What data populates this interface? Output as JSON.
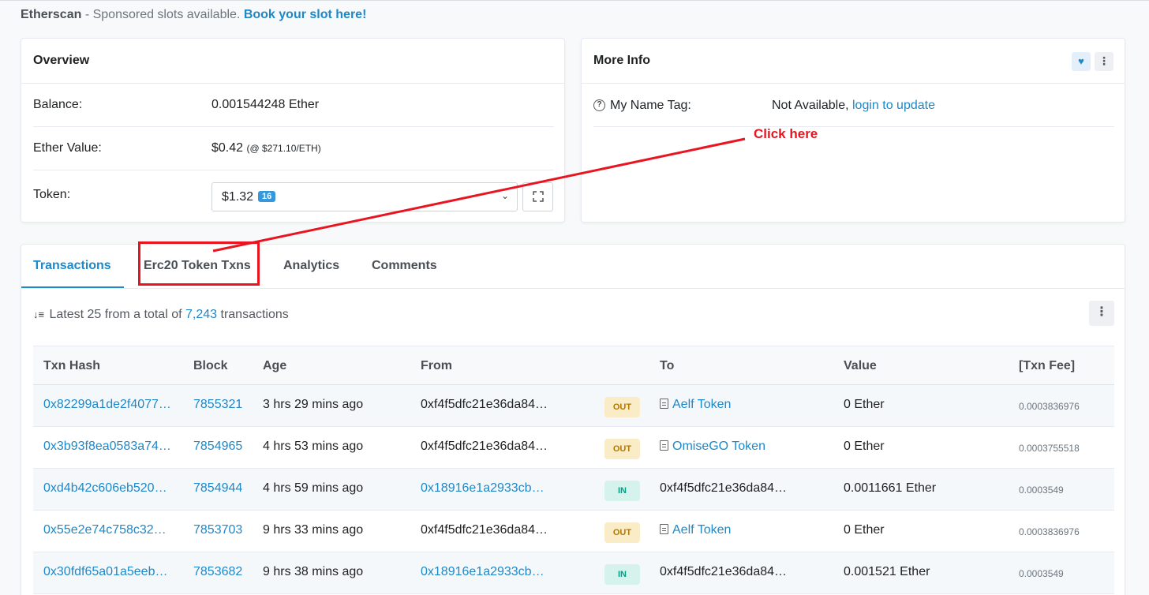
{
  "sponsor": {
    "brand": "Etherscan",
    "text": " - Sponsored slots available. ",
    "link": "Book your slot here!"
  },
  "overview": {
    "title": "Overview",
    "balance_label": "Balance:",
    "balance_value": "0.001544248 Ether",
    "ether_value_label": "Ether Value:",
    "ether_value": "$0.42",
    "ether_rate": "(@ $271.10/ETH)",
    "token_label": "Token:",
    "token_value": "$1.32",
    "token_count": "16"
  },
  "more_info": {
    "title": "More Info",
    "name_tag_label": "My Name Tag:",
    "name_tag_value": "Not Available, ",
    "name_tag_link": "login to update"
  },
  "annotation": {
    "text": "Click here",
    "color": "#e8141f"
  },
  "tabs": [
    {
      "label": "Transactions",
      "active": true
    },
    {
      "label": "Erc20 Token Txns"
    },
    {
      "label": "Analytics"
    },
    {
      "label": "Comments"
    }
  ],
  "summary": {
    "prefix": "Latest 25 from a total of ",
    "count": "7,243",
    "suffix": " transactions"
  },
  "table": {
    "headers": [
      "Txn Hash",
      "Block",
      "Age",
      "From",
      "To",
      "Value",
      "[Txn Fee]"
    ],
    "rows": [
      {
        "hash": "0x82299a1de2f4077…",
        "block": "7855321",
        "age": "3 hrs 29 mins ago",
        "from": "0xf4f5dfc21e36da84…",
        "dir": "OUT",
        "to": "Aelf Token",
        "value": "0 Ether",
        "fee": "0.0003836976"
      },
      {
        "hash": "0x3b93f8ea0583a74…",
        "block": "7854965",
        "age": "4 hrs 53 mins ago",
        "from": "0xf4f5dfc21e36da84…",
        "dir": "OUT",
        "to": "OmiseGO Token",
        "value": "0 Ether",
        "fee": "0.0003755518"
      },
      {
        "hash": "0xd4b42c606eb520…",
        "block": "7854944",
        "age": "4 hrs 59 mins ago",
        "from": "0x18916e1a2933cb…",
        "dir": "IN",
        "to": "0xf4f5dfc21e36da84…",
        "value": "0.0011661 Ether",
        "fee": "0.0003549"
      },
      {
        "hash": "0x55e2e74c758c32…",
        "block": "7853703",
        "age": "9 hrs 33 mins ago",
        "from": "0xf4f5dfc21e36da84…",
        "dir": "OUT",
        "to": "Aelf Token",
        "value": "0 Ether",
        "fee": "0.0003836976"
      },
      {
        "hash": "0x30fdf65a01a5eeb…",
        "block": "7853682",
        "age": "9 hrs 38 mins ago",
        "from": "0x18916e1a2933cb…",
        "dir": "IN",
        "to": "0xf4f5dfc21e36da84…",
        "value": "0.001521 Ether",
        "fee": "0.0003549"
      }
    ]
  },
  "colors": {
    "link": "#1e88c8",
    "out_badge": "#fbecc8",
    "in_badge": "#d5f2ec"
  }
}
